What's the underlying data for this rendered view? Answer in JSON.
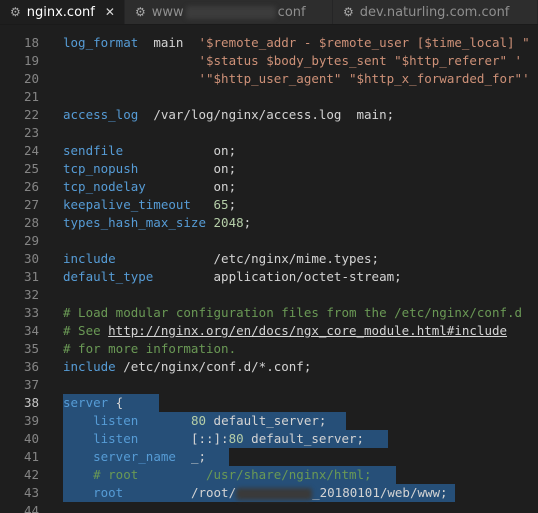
{
  "tabs": [
    {
      "label": "nginx.conf",
      "icon": "gear-icon",
      "active": true,
      "close": "✕"
    },
    {
      "label_prefix": "www",
      "label_suffix": "conf",
      "icon": "gear-icon",
      "active": false
    },
    {
      "label": "dev.naturling.com.conf",
      "icon": "gear-icon",
      "active": false
    }
  ],
  "editor": {
    "lines": [
      {
        "n": "18",
        "html": "    <span class='kw'>log_format</span>  main  <span class='str'>'$remote_addr - $remote_user [$time_local] \"</span>"
      },
      {
        "n": "19",
        "html": "                      <span class='str'>'$status $body_bytes_sent \"$http_referer\" '</span>"
      },
      {
        "n": "20",
        "html": "                      <span class='str'>'\"$http_user_agent\" \"$http_x_forwarded_for\"'</span>"
      },
      {
        "n": "21",
        "html": ""
      },
      {
        "n": "22",
        "html": "    <span class='kw'>access_log</span>  /var/log/nginx/access.log  main;"
      },
      {
        "n": "23",
        "html": ""
      },
      {
        "n": "24",
        "html": "    <span class='kw'>sendfile</span>            on;"
      },
      {
        "n": "25",
        "html": "    <span class='kw'>tcp_nopush</span>          on;"
      },
      {
        "n": "26",
        "html": "    <span class='kw'>tcp_nodelay</span>         on;"
      },
      {
        "n": "27",
        "html": "    <span class='kw'>keepalive_timeout</span>   <span class='num'>65</span>;"
      },
      {
        "n": "28",
        "html": "    <span class='kw'>types_hash_max_size</span> <span class='num'>2048</span>;"
      },
      {
        "n": "29",
        "html": ""
      },
      {
        "n": "30",
        "html": "    <span class='kw'>include</span>             /etc/nginx/mime.types;"
      },
      {
        "n": "31",
        "html": "    <span class='kw'>default_type</span>        application/octet-stream;"
      },
      {
        "n": "32",
        "html": ""
      },
      {
        "n": "33",
        "html": "    <span class='cmt'># Load modular configuration files from the /etc/nginx/conf.d</span>"
      },
      {
        "n": "34",
        "html": "    <span class='cmt'># See </span><span class='url'>http://nginx.org/en/docs/ngx_core_module.html#include</span>"
      },
      {
        "n": "35",
        "html": "    <span class='cmt'># for more information.</span>"
      },
      {
        "n": "36",
        "html": "    <span class='kw'>include</span> /etc/nginx/conf.d/*.conf;"
      },
      {
        "n": "37",
        "html": ""
      },
      {
        "n": "38",
        "html": "    <span class='kw'>server</span> {"
      },
      {
        "n": "39",
        "html": "        <span class='kw'>listen</span>       <span class='num'>80</span> default_server;"
      },
      {
        "n": "40",
        "html": "        <span class='kw'>listen</span>       [::]:<span class='num'>80</span> default_server;"
      },
      {
        "n": "41",
        "html": "        <span class='kw'>server_name</span>  _;"
      },
      {
        "n": "42",
        "html": "        <span class='cmt'># root         /usr/share/nginx/html;</span>"
      },
      {
        "n": "43",
        "html": "        <span class='kw'>root</span>         /root/<span class='blurspan'></span>_20180101/web/www;"
      },
      {
        "n": "44",
        "html": ""
      }
    ],
    "current_line": "38"
  }
}
